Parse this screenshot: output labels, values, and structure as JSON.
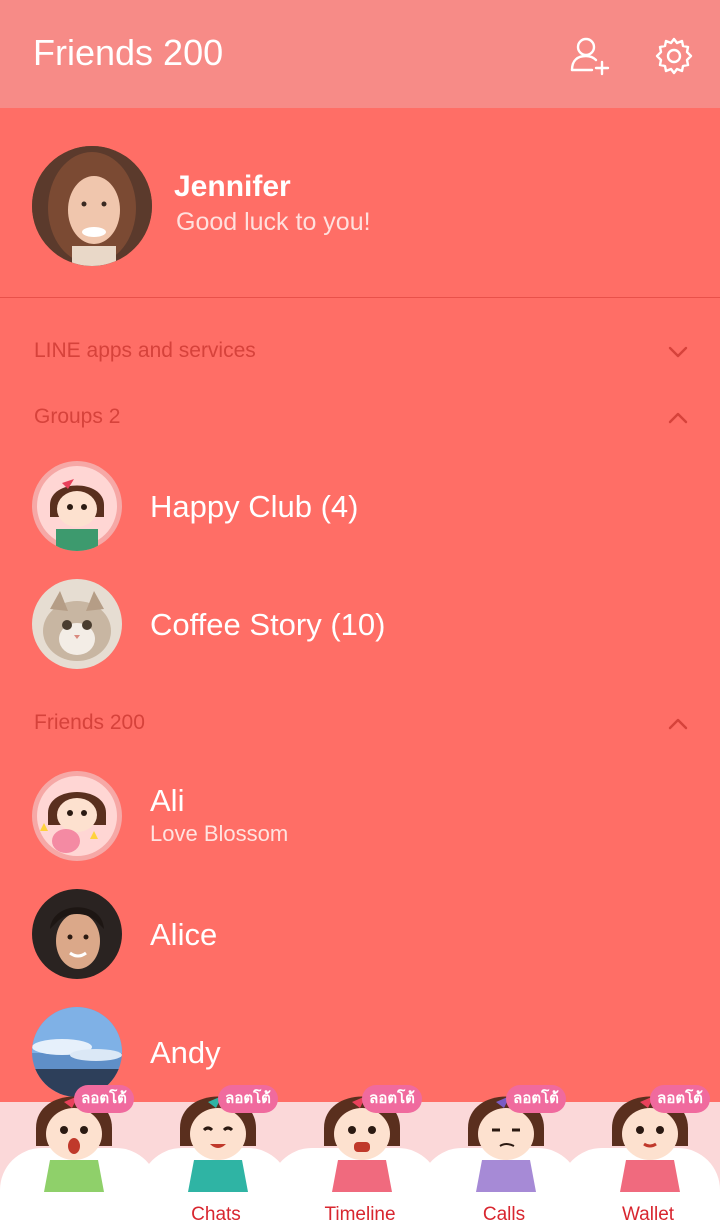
{
  "header": {
    "title": "Friends 200",
    "add_friend_icon": "add-friend-icon",
    "settings_icon": "gear-icon"
  },
  "profile": {
    "name": "Jennifer",
    "status": "Good luck to you!"
  },
  "sections": {
    "line_apps": "LINE apps and services",
    "groups": "Groups 2",
    "friends": "Friends 200"
  },
  "groups": [
    {
      "name": "Happy Club (4)"
    },
    {
      "name": "Coffee Story (10)"
    }
  ],
  "friends": [
    {
      "name": "Ali",
      "status": "Love Blossom"
    },
    {
      "name": "Alice"
    },
    {
      "name": "Andy"
    }
  ],
  "tabs": [
    {
      "label": "",
      "badge": "ลอตโต้"
    },
    {
      "label": "Chats",
      "badge": "ลอตโต้"
    },
    {
      "label": "Timeline",
      "badge": "ลอตโต้"
    },
    {
      "label": "Calls",
      "badge": "ลอตโต้"
    },
    {
      "label": "Wallet",
      "badge": "ลอตโต้"
    }
  ],
  "colors": {
    "background": "#FF6E66",
    "header": "#F78B87",
    "section_label": "#D6423B",
    "tab_label": "#D8262F"
  }
}
